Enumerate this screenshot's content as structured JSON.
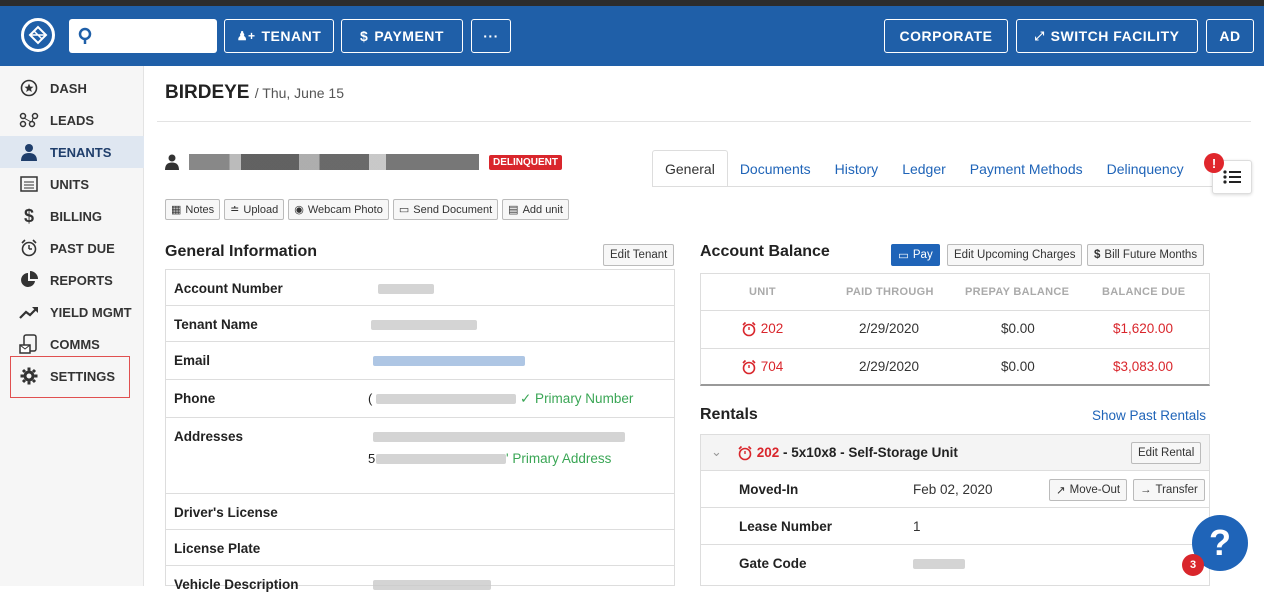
{
  "topbar": {
    "search_placeholder": "",
    "tenant_label": "TENANT",
    "payment_label": "PAYMENT",
    "more_label": "···",
    "corporate_label": "CORPORATE",
    "switch_label": "SWITCH FACILITY",
    "user_label": "AD"
  },
  "sidebar": {
    "items": [
      {
        "label": "DASH",
        "icon": "star-circle-icon"
      },
      {
        "label": "LEADS",
        "icon": "nodes-icon"
      },
      {
        "label": "TENANTS",
        "icon": "person-icon"
      },
      {
        "label": "UNITS",
        "icon": "units-icon"
      },
      {
        "label": "BILLING",
        "icon": "dollar-icon"
      },
      {
        "label": "PAST DUE",
        "icon": "alarm-icon"
      },
      {
        "label": "REPORTS",
        "icon": "pie-icon"
      },
      {
        "label": "YIELD MGMT",
        "icon": "trend-icon"
      },
      {
        "label": "COMMS",
        "icon": "comms-icon"
      },
      {
        "label": "SETTINGS",
        "icon": "gear-icon"
      }
    ],
    "active": "TENANTS"
  },
  "page": {
    "title": "BIRDEYE",
    "date": "/ Thu, June 15"
  },
  "tenant": {
    "status_badge": "DELINQUENT"
  },
  "tabs": [
    "General",
    "Documents",
    "History",
    "Ledger",
    "Payment Methods",
    "Delinquency"
  ],
  "alert_count": "!",
  "actions": [
    "Notes",
    "Upload",
    "Webcam Photo",
    "Send Document",
    "Add unit"
  ],
  "general": {
    "title": "General Information",
    "edit_label": "Edit Tenant",
    "rows": {
      "account_number": "Account Number",
      "tenant_name": "Tenant Name",
      "email": "Email",
      "phone": "Phone",
      "addresses": "Addresses",
      "drivers_license": "Driver's License",
      "license_plate": "License Plate",
      "vehicle_description": "Vehicle Description"
    },
    "phone_primary": "✓ Primary Number",
    "address_primary": "' Primary Address",
    "address_prefix": "5",
    "phone_prefix": "("
  },
  "balance": {
    "title": "Account Balance",
    "pay_label": "Pay",
    "upcoming_label": "Edit Upcoming Charges",
    "future_label": "Bill Future Months",
    "headers": [
      "UNIT",
      "PAID THROUGH",
      "PREPAY BALANCE",
      "BALANCE DUE"
    ],
    "rows": [
      {
        "unit": "202",
        "paid_through": "2/29/2020",
        "prepay": "$0.00",
        "due": "$1,620.00"
      },
      {
        "unit": "704",
        "paid_through": "2/29/2020",
        "prepay": "$0.00",
        "due": "$3,083.00"
      }
    ],
    "accent": "#d9262c"
  },
  "rentals": {
    "title": "Rentals",
    "show_past": "Show Past Rentals",
    "unit": "202",
    "unit_desc": " - 5x10x8 - Self-Storage Unit",
    "edit_label": "Edit Rental",
    "moved_in_label": "Moved-In",
    "moved_in_value": "Feb 02, 2020",
    "move_out_label": "Move-Out",
    "transfer_label": "Transfer",
    "lease_label": "Lease Number",
    "lease_value": "1",
    "gate_label": "Gate Code"
  },
  "help": {
    "icon": "?",
    "count": "3"
  },
  "colors": {
    "topbar": "#1f5fa8",
    "link": "#1f64b8",
    "danger": "#d9262c",
    "success": "#3aa655"
  }
}
